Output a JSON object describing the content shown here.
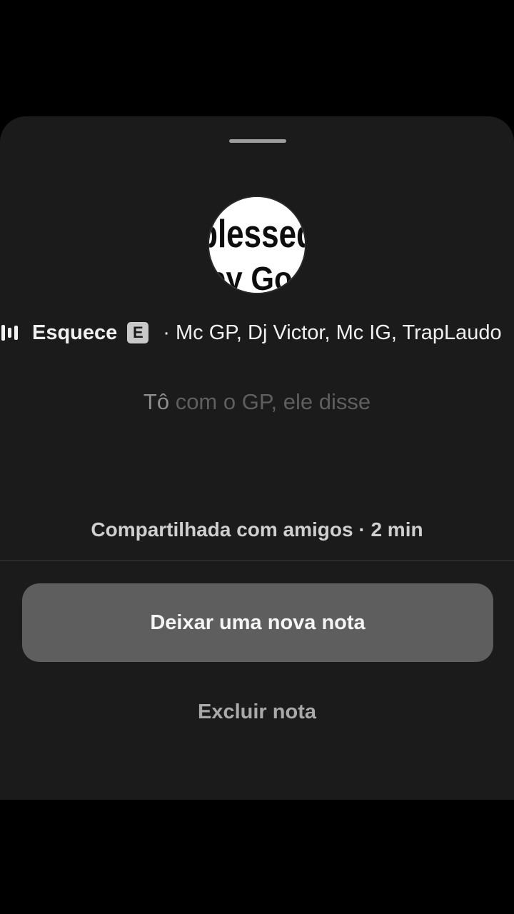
{
  "sheet": {
    "avatar_alt": "blessed by God"
  },
  "music": {
    "icon": "equalizer-icon",
    "title": "Esquece",
    "explicit_badge": "E",
    "artists": "· Mc GP, Dj Victor, Mc IG, TrapLaudo"
  },
  "note": {
    "first_word": "Tô",
    "rest": " com o GP, ele disse"
  },
  "shared_info": "Compartilhada com amigos · 2 min",
  "actions": {
    "new_note_label": "Deixar uma nova nota",
    "delete_note_label": "Excluir nota"
  },
  "colors": {
    "background": "#000000",
    "sheet": "#1b1b1b",
    "button": "#5e5e5e"
  }
}
